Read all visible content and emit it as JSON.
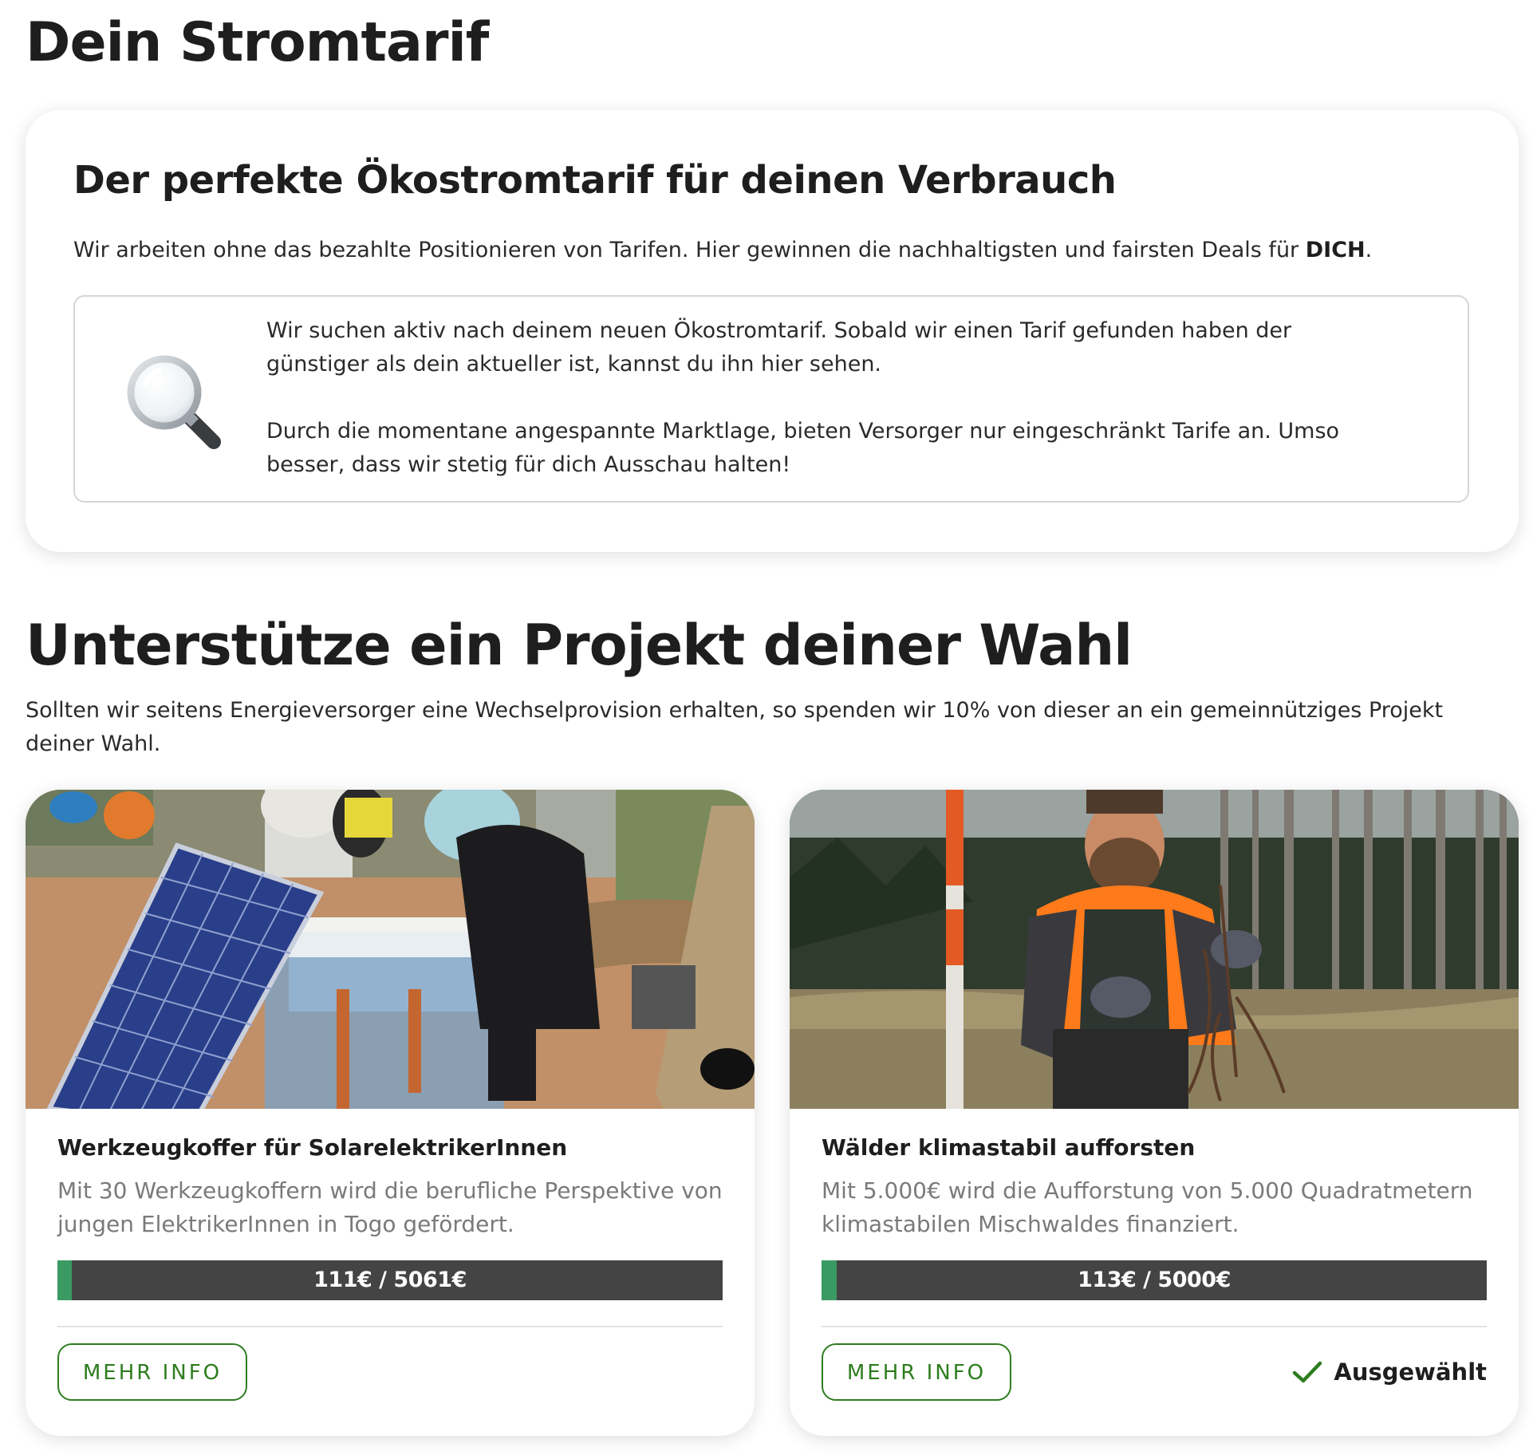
{
  "page_title": "Dein Stromtarif",
  "tariff": {
    "title": "Der perfekte Ökostromtarif für deinen Verbrauch",
    "subtitle_text": "Wir arbeiten ohne das bezahlte Positionieren von Tarifen. Hier gewinnen die nachhaltigsten und fairsten Deals für ",
    "subtitle_bold": "DICH",
    "subtitle_end": ".",
    "info_icon": "magnifying-glass-icon",
    "info_paragraph_1": "Wir suchen aktiv nach deinem neuen Ökostromtarif. Sobald wir einen Tarif gefunden haben der günstiger als dein aktueller ist, kannst du ihn hier sehen.",
    "info_paragraph_2": "Durch die momentane angespannte Marktlage, bieten Versorger nur eingeschränkt Tarife an. Umso besser, dass wir stetig für dich Ausschau halten!"
  },
  "projects": {
    "title": "Unterstütze ein Projekt deiner Wahl",
    "intro": "Sollten wir seitens Energieversorger eine Wechselprovision erhalten, so spenden wir 10% von dieser an ein gemeinnütziges Projekt deiner Wahl.",
    "items": [
      {
        "title": "Werkzeugkoffer für SolarelektrikerInnen",
        "description": "Mit 30 Werkzeugkoffern wird die berufliche Perspektive von jungen ElektrikerInnen in Togo gefördert.",
        "progress_label": "111€ / 5061€",
        "progress_fraction": 0.0219,
        "button_label": "MEHR INFO",
        "selected": false
      },
      {
        "title": "Wälder klimastabil aufforsten",
        "description": "Mit 5.000€ wird die Aufforstung von 5.000 Quadratmetern klimastabilen Mischwaldes finanziert.",
        "progress_label": "113€ / 5000€",
        "progress_fraction": 0.0226,
        "button_label": "MEHR INFO",
        "selected": true,
        "selected_label": "Ausgewählt"
      }
    ]
  },
  "colors": {
    "accent_green": "#2e7d1f",
    "progress_fill": "#3a9b62",
    "progress_track": "#444444"
  }
}
